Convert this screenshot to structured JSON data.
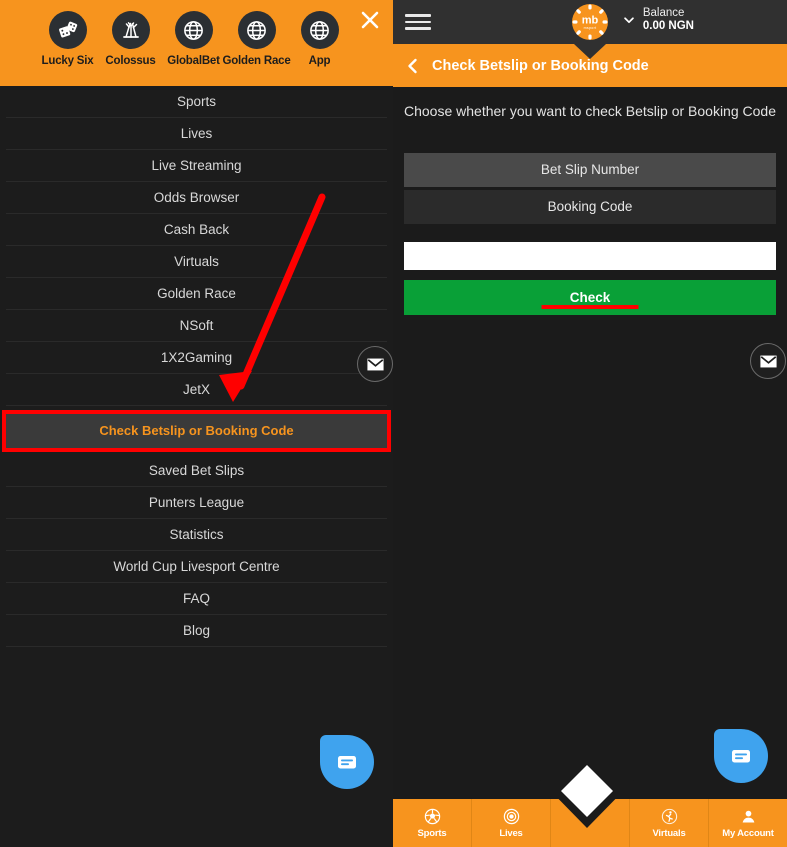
{
  "colors": {
    "brand_orange": "#F7941E",
    "panel_dark": "#1c1c1c",
    "topbar_dark": "#303030",
    "highlight_red": "#ff0000",
    "check_green": "#09a037",
    "chat_blue": "#3fa3ee"
  },
  "left_panel": {
    "quicklinks": [
      {
        "label": "Lucky Six",
        "icon": "dice-icon"
      },
      {
        "label": "Colossus",
        "icon": "fireworks-icon"
      },
      {
        "label": "GlobalBet",
        "icon": "globe-icon"
      },
      {
        "label": "Golden Race",
        "icon": "globe-icon"
      },
      {
        "label": "App",
        "icon": "globe-icon"
      }
    ],
    "close_label": "close-icon",
    "menu_items": [
      {
        "label": "Sports",
        "highlighted": false
      },
      {
        "label": "Lives",
        "highlighted": false
      },
      {
        "label": "Live Streaming",
        "highlighted": false
      },
      {
        "label": "Odds Browser",
        "highlighted": false
      },
      {
        "label": "Cash Back",
        "highlighted": false
      },
      {
        "label": "Virtuals",
        "highlighted": false
      },
      {
        "label": "Golden Race",
        "highlighted": false
      },
      {
        "label": "NSoft",
        "highlighted": false
      },
      {
        "label": "1X2Gaming",
        "highlighted": false
      },
      {
        "label": "JetX",
        "highlighted": false
      },
      {
        "label": "Check Betslip or Booking Code",
        "highlighted": true
      },
      {
        "label": "Saved Bet Slips",
        "highlighted": false
      },
      {
        "label": "Punters League",
        "highlighted": false
      },
      {
        "label": "Statistics",
        "highlighted": false
      },
      {
        "label": "World Cup Livesport Centre",
        "highlighted": false
      },
      {
        "label": "FAQ",
        "highlighted": false
      },
      {
        "label": "Blog",
        "highlighted": false
      }
    ]
  },
  "right_panel": {
    "topbar": {
      "menu_icon": "hamburger-icon",
      "logo_text": "mb",
      "logo_sub": "msport",
      "balance_label": "Balance",
      "balance_amount": "0.00 NGN",
      "balance_chevron": "chevron-down-icon"
    },
    "header": {
      "back_icon": "chevron-left-icon",
      "title": "Check Betslip or Booking Code"
    },
    "content": {
      "intro": "Choose whether you want to check Betslip or Booking Code",
      "tab_betslip": "Bet Slip Number",
      "tab_booking": "Booking Code",
      "input_value": "",
      "input_placeholder": "",
      "submit_label": "Check"
    },
    "bottom_nav": [
      {
        "label": "Sports",
        "icon": "football-icon"
      },
      {
        "label": "Lives",
        "icon": "live-target-icon"
      },
      {
        "label": "",
        "icon": "diamond-icon"
      },
      {
        "label": "Virtuals",
        "icon": "runner-icon"
      },
      {
        "label": "My Account",
        "icon": "person-icon"
      }
    ],
    "mail_fab": "envelope-icon",
    "chat_fab": "chat-bubble-icon"
  },
  "annotations": {
    "arrow": "red-arrow-pointing-to-check-betslip-menu-item",
    "highlight_box": "red-rectangle-around-check-betslip-menu-item",
    "underline": "red-underline-under-check-button"
  }
}
